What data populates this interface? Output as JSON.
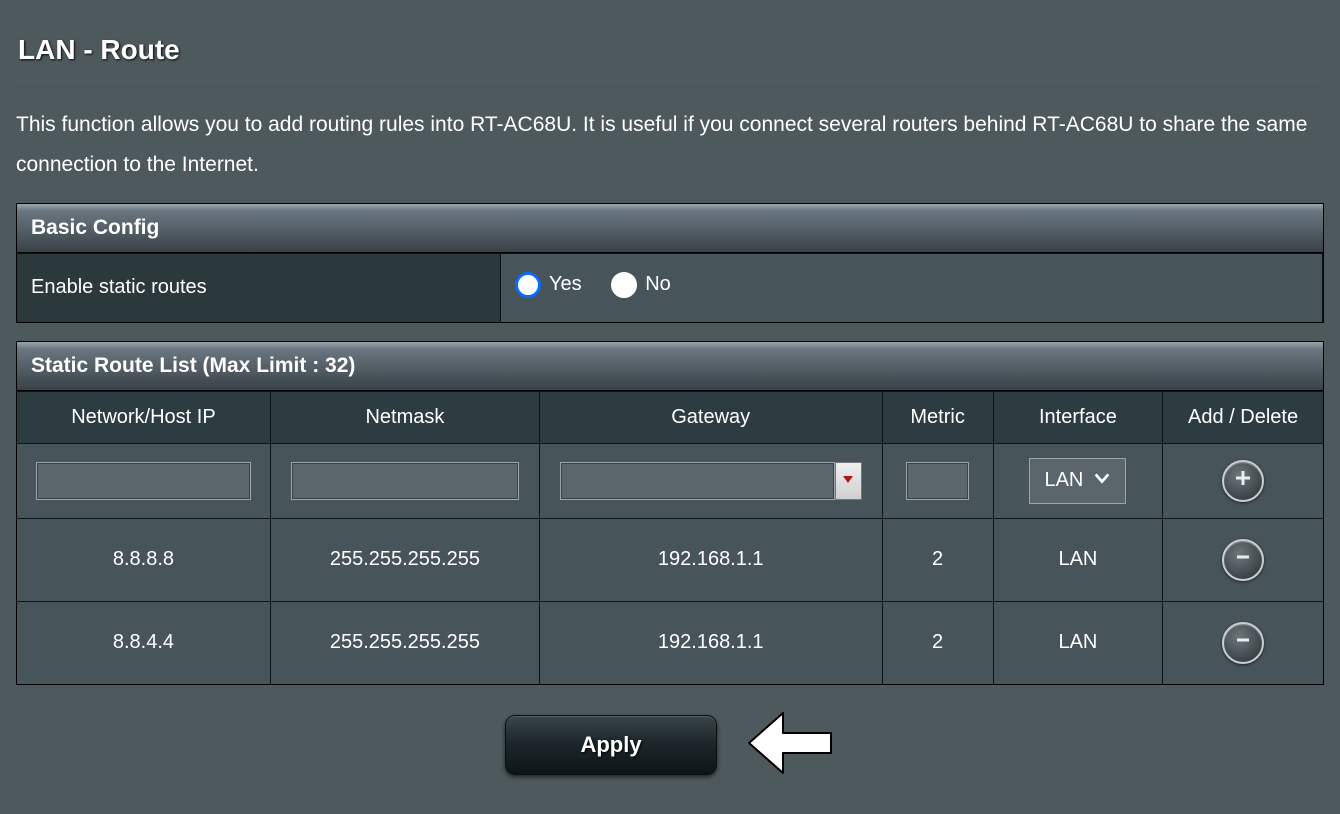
{
  "page": {
    "title": "LAN - Route",
    "description": "This function allows you to add routing rules into RT-AC68U. It is useful if you connect several routers behind RT-AC68U to share the same connection to the Internet."
  },
  "basic_config": {
    "header": "Basic Config",
    "enable_label": "Enable static routes",
    "options": {
      "yes": "Yes",
      "no": "No"
    },
    "selected": "yes"
  },
  "route_list": {
    "header": "Static Route List (Max Limit : 32)",
    "columns": {
      "ip": "Network/Host IP",
      "netmask": "Netmask",
      "gateway": "Gateway",
      "metric": "Metric",
      "interface": "Interface",
      "action": "Add / Delete"
    },
    "new_row": {
      "ip": "",
      "netmask": "",
      "gateway": "",
      "metric": "",
      "interface": "LAN"
    },
    "rows": [
      {
        "ip": "8.8.8.8",
        "netmask": "255.255.255.255",
        "gateway": "192.168.1.1",
        "metric": "2",
        "interface": "LAN"
      },
      {
        "ip": "8.8.4.4",
        "netmask": "255.255.255.255",
        "gateway": "192.168.1.1",
        "metric": "2",
        "interface": "LAN"
      }
    ]
  },
  "footer": {
    "apply": "Apply"
  }
}
